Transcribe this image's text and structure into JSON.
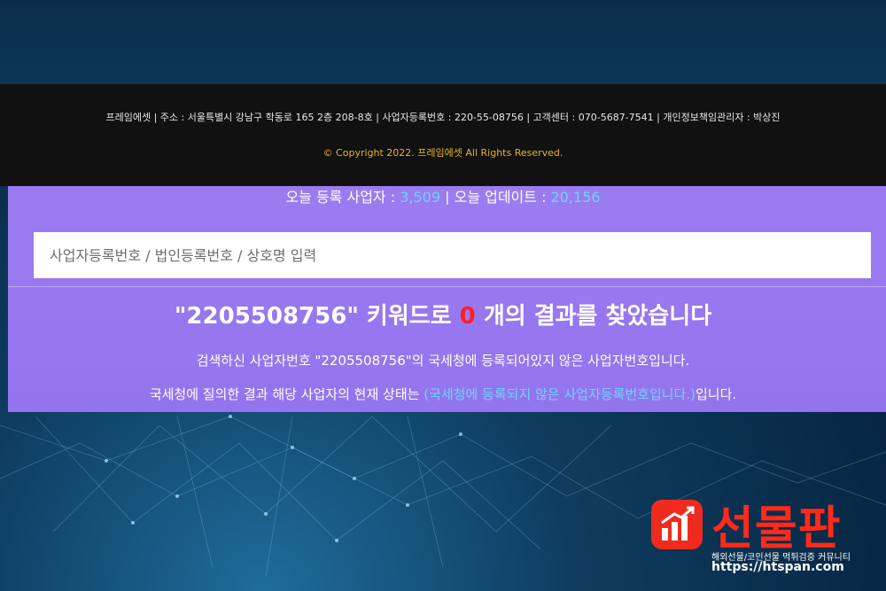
{
  "footer": {
    "info": "프레임에셋 | 주소 : 서울특별시 강남구 학동로 165 2층 208-8호 | 사업자등록번호 : 220-55-08756 | 고객센터 : 070-5687-7541 | 개인정보책임관리자 : 박상진",
    "copyright": "© Copyright 2022. 프레임에셋 All Rights Reserved."
  },
  "stats": {
    "today_registered_label": "오늘 등록 사업자 : ",
    "today_registered_value": "3,509",
    "separator": " | ",
    "today_updated_label": "오늘 업데이트 : ",
    "today_updated_value": "20,156"
  },
  "search": {
    "placeholder": "사업자등록번호 / 법인등록번호 / 상호명 입력"
  },
  "result": {
    "title_prefix": "\"2205508756\" 키워드로 ",
    "count": "0",
    "title_suffix": " 개의 결과를 찾았습니다",
    "description": "검색하신 사업자번호 \"2205508756\"의 국세청에 등록되어있지 않은 사업자번호입니다.",
    "status_prefix": "국세청에 질의한 결과 해당 사업자의 현재 상태는 ",
    "status_value": "(국세청에 등록되지 않은 사업자등록번호입니다.)",
    "status_suffix": "입니다."
  },
  "logo": {
    "name": "선물판",
    "tagline": "해외선물/코인선물 먹튀검증 커뮤니티",
    "url": "https://htspan.com"
  },
  "colors": {
    "panel": "#9474ee",
    "highlight": "#6fd3ff",
    "count_red": "#ff1f1f",
    "copyright_gold": "#e7b520",
    "logo_red": "#ef2b1f"
  }
}
